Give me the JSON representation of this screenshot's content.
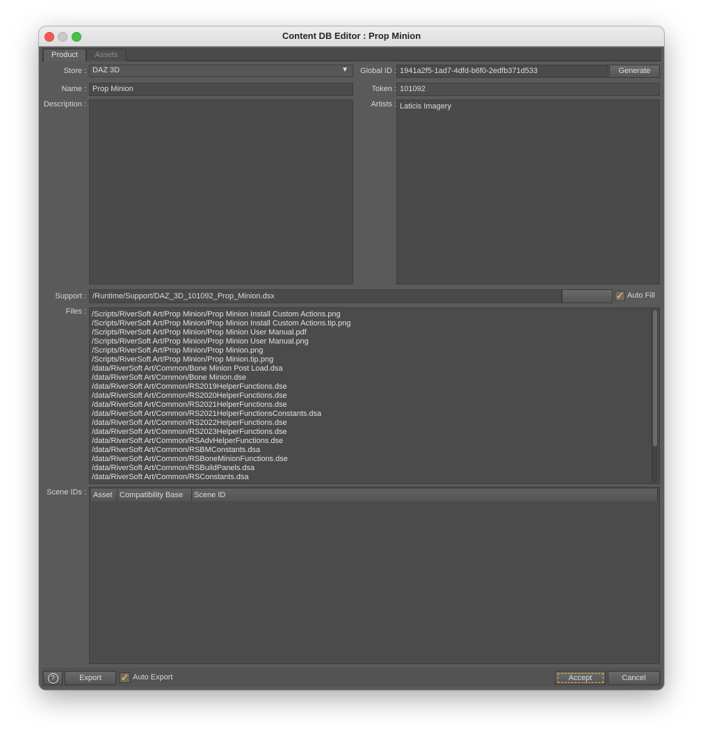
{
  "window": {
    "title": "Content DB Editor : Prop Minion"
  },
  "tabs": [
    {
      "label": "Product"
    },
    {
      "label": "Assets"
    }
  ],
  "labels": {
    "store": "Store :",
    "global_id": "Global ID :",
    "name": "Name :",
    "token": "Token :",
    "description": "Description :",
    "artists": "Artists :",
    "support": "Support :",
    "files": "Files :",
    "scene_ids": "Scene IDs :"
  },
  "values": {
    "store": "DAZ 3D",
    "global_id": "1941a2f5-1ad7-4dfd-b6f0-2edfb371d533",
    "name": "Prop Minion",
    "token": "101092",
    "description": "",
    "artists": "Laticis Imagery",
    "support": "/Runtime/Support/DAZ_3D_101092_Prop_Minion.dsx"
  },
  "buttons": {
    "generate": "Generate",
    "export": "Export",
    "accept": "Accept",
    "cancel": "Cancel",
    "help": "?"
  },
  "checks": {
    "auto_fill_label": "Auto Fill",
    "auto_fill_checked": true,
    "auto_export_label": "Auto Export",
    "auto_export_checked": true
  },
  "files": [
    "/Scripts/RiverSoft Art/Prop Minion/Prop Minion Install Custom Actions.png",
    "/Scripts/RiverSoft Art/Prop Minion/Prop Minion Install Custom Actions.tip.png",
    "/Scripts/RiverSoft Art/Prop Minion/Prop Minion User Manual.pdf",
    "/Scripts/RiverSoft Art/Prop Minion/Prop Minion User Manual.png",
    "/Scripts/RiverSoft Art/Prop Minion/Prop Minion.png",
    "/Scripts/RiverSoft Art/Prop Minion/Prop Minion.tip.png",
    "/data/RiverSoft Art/Common/Bone Minion Post Load.dsa",
    "/data/RiverSoft Art/Common/Bone Minion.dse",
    "/data/RiverSoft Art/Common/RS2019HelperFunctions.dse",
    "/data/RiverSoft Art/Common/RS2020HelperFunctions.dse",
    "/data/RiverSoft Art/Common/RS2021HelperFunctions.dse",
    "/data/RiverSoft Art/Common/RS2021HelperFunctionsConstants.dsa",
    "/data/RiverSoft Art/Common/RS2022HelperFunctions.dse",
    "/data/RiverSoft Art/Common/RS2023HelperFunctions.dse",
    "/data/RiverSoft Art/Common/RSAdvHelperFunctions.dse",
    "/data/RiverSoft Art/Common/RSBMConstants.dsa",
    "/data/RiverSoft Art/Common/RSBoneMinionFunctions.dse",
    "/data/RiverSoft Art/Common/RSBuildPanels.dsa",
    "/data/RiverSoft Art/Common/RSConstants.dsa"
  ],
  "scene_ids_table": {
    "columns": [
      "Asset",
      "Compatibility Base",
      "Scene ID"
    ]
  },
  "colors": {
    "window_bg": "#5a5a5a",
    "field_bg": "#4a4a4a",
    "check_accent": "#f2b233"
  }
}
